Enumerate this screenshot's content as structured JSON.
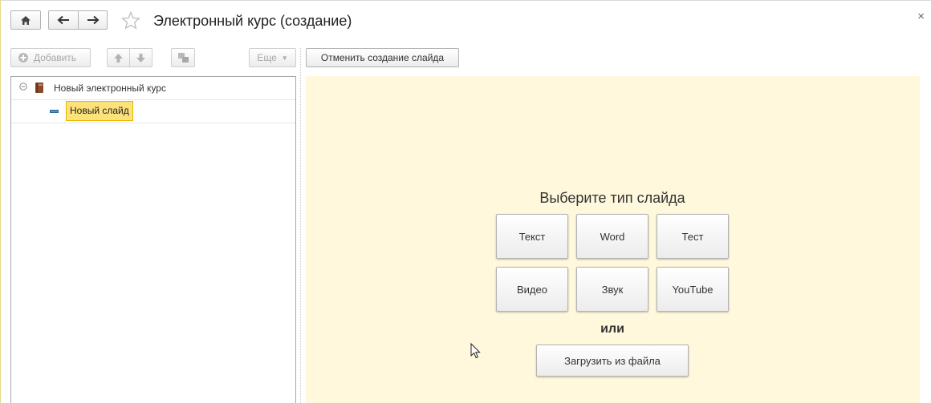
{
  "window": {
    "title": "Электронный курс (создание)",
    "close_glyph": "×"
  },
  "tree_toolbar": {
    "add_label": "Добавить",
    "more_label": "Еще"
  },
  "workspace_toolbar": {
    "cancel_label": "Отменить создание слайда"
  },
  "tree": {
    "root_label": "Новый электронный курс",
    "child_label": "Новый слайд"
  },
  "slide_chooser": {
    "heading": "Выберите тип слайда",
    "types": [
      "Текст",
      "Word",
      "Тест",
      "Видео",
      "Звук",
      "YouTube"
    ],
    "or_label": "или",
    "upload_label": "Загрузить из файла"
  },
  "colors": {
    "workspace_bg": "#fff8dc",
    "selection_bg": "#fde27a",
    "selection_border": "#e6b800"
  }
}
